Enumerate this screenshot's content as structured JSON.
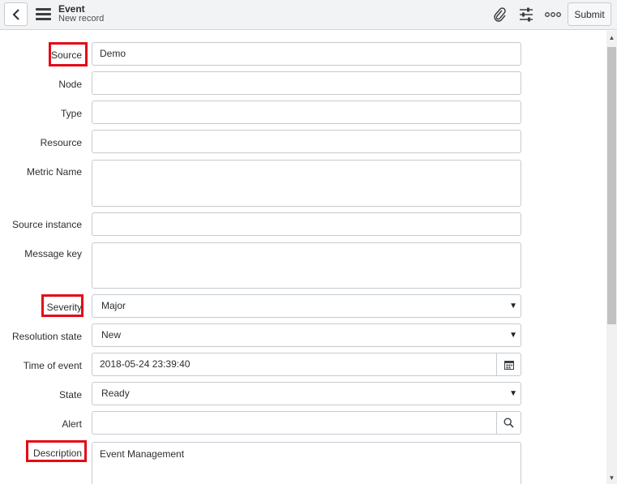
{
  "header": {
    "title": "Event",
    "subtitle": "New record",
    "submit_label": "Submit"
  },
  "icons": {
    "back": "chevron-left-icon",
    "menu": "hamburger-menu-icon",
    "attach": "paperclip-icon",
    "settings": "sliders-icon",
    "more": "more-options-icon",
    "calendar": "calendar-icon",
    "lookup": "search-icon"
  },
  "colors": {
    "highlight": "#e30b17",
    "header_bg": "#f2f3f4",
    "border": "#c6cacf"
  },
  "form": {
    "source": {
      "label": "Source",
      "value": "Demo"
    },
    "node": {
      "label": "Node",
      "value": ""
    },
    "type": {
      "label": "Type",
      "value": ""
    },
    "resource": {
      "label": "Resource",
      "value": ""
    },
    "metric_name": {
      "label": "Metric Name",
      "value": ""
    },
    "source_instance": {
      "label": "Source instance",
      "value": ""
    },
    "message_key": {
      "label": "Message key",
      "value": ""
    },
    "severity": {
      "label": "Severity",
      "value": "Major"
    },
    "resolution_state": {
      "label": "Resolution state",
      "value": "New"
    },
    "time_of_event": {
      "label": "Time of event",
      "value": "2018-05-24 23:39:40"
    },
    "state": {
      "label": "State",
      "value": "Ready"
    },
    "alert": {
      "label": "Alert",
      "value": ""
    },
    "description": {
      "label": "Description",
      "value": "Event Management"
    }
  }
}
